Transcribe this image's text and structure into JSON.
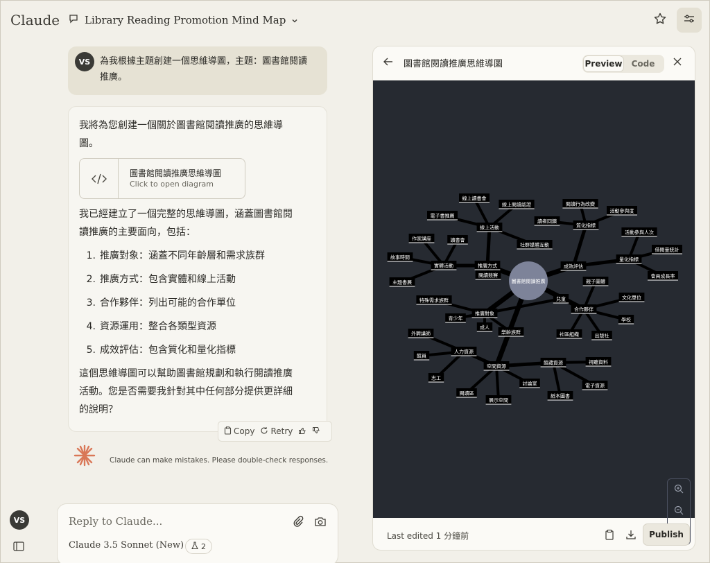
{
  "app": {
    "brand": "Claude"
  },
  "header": {
    "chat_title": "Library Reading Promotion Mind Map"
  },
  "user": {
    "initials": "VS",
    "message": "為我根據主題創建一個思維導圖，主題：圖書館閱讀推廣。"
  },
  "assistant": {
    "intro": "我將為您創建一個關於圖書館閱讀推廣的思維導圖。",
    "artifact_card": {
      "title": "圖書館閱讀推廣思維導圖",
      "subtitle": "Click to open diagram"
    },
    "summary": "我已經建立了一個完整的思維導圖，涵蓋圖書館閱讀推廣的主要面向，包括：",
    "points": [
      {
        "num": "1.",
        "text": "推廣對象：涵蓋不同年齡層和需求族群"
      },
      {
        "num": "2.",
        "text": "推廣方式：包含實體和線上活動"
      },
      {
        "num": "3.",
        "text": "合作夥伴：列出可能的合作單位"
      },
      {
        "num": "4.",
        "text": "資源運用：整合各類型資源"
      },
      {
        "num": "5.",
        "text": "成效評估：包含質化和量化指標"
      }
    ],
    "closing": "這個思維導圖可以幫助圖書館規劃和執行閱讀推廣活動。您是否需要我針對其中任何部分提供更詳細的說明？",
    "actions": {
      "copy": "Copy",
      "retry": "Retry"
    }
  },
  "disclaimer": "Claude can make mistakes. Please double-check responses.",
  "reply": {
    "placeholder": "Reply to Claude...",
    "model": "Claude 3.5 Sonnet (New)",
    "style_count": "2"
  },
  "panel": {
    "title": "圖書館閱讀推廣思維導圖",
    "tabs": {
      "preview": "Preview",
      "code": "Code"
    },
    "footer": {
      "last_edited": "Last edited 1 分鐘前",
      "publish": "Publish"
    }
  },
  "mindmap": {
    "center": "圖書館閱讀推廣",
    "nodes": [
      {
        "id": "fs",
        "label": "推廣方式"
      },
      {
        "id": "dx",
        "label": "推廣對象"
      },
      {
        "id": "hz",
        "label": "合作夥伴"
      },
      {
        "id": "zy",
        "label": "空間資源"
      },
      {
        "id": "pg",
        "label": "成效評估"
      },
      {
        "id": "xs",
        "label": "線上活動"
      },
      {
        "id": "st",
        "label": "實體活動"
      },
      {
        "id": "zl",
        "label": "閱讀競賽"
      },
      {
        "id": "xsdsh",
        "label": "線上讀書會"
      },
      {
        "id": "xsydlc",
        "label": "線上閱讀認證"
      },
      {
        "id": "dzsh",
        "label": "電子書推薦"
      },
      {
        "id": "sjmt",
        "label": "社群媒體互動"
      },
      {
        "id": "zjjz",
        "label": "作家講座"
      },
      {
        "id": "dsh",
        "label": "讀書會"
      },
      {
        "id": "gssj",
        "label": "故事時間"
      },
      {
        "id": "zsd",
        "label": "主題書展"
      },
      {
        "id": "zhbz",
        "label": "質化指標"
      },
      {
        "id": "ydxw",
        "label": "閱讀行為改變"
      },
      {
        "id": "dzfk",
        "label": "讀者回饋"
      },
      {
        "id": "hdcy",
        "label": "活動參與度"
      },
      {
        "id": "lhzb",
        "label": "量化指標"
      },
      {
        "id": "hdcyrc",
        "label": "活動參與人次"
      },
      {
        "id": "jyl",
        "label": "借閱量統計"
      },
      {
        "id": "hysz",
        "label": "會員成長率"
      },
      {
        "id": "tsxq",
        "label": "特殊需求族群"
      },
      {
        "id": "qsn",
        "label": "青少年"
      },
      {
        "id": "cr",
        "label": "成人"
      },
      {
        "id": "etq",
        "label": "兒童"
      },
      {
        "id": "lnz",
        "label": "樂齡族群"
      },
      {
        "id": "jzxh",
        "label": "親子團體"
      },
      {
        "id": "whdw",
        "label": "文化單位"
      },
      {
        "id": "xx",
        "label": "學校"
      },
      {
        "id": "cbs",
        "label": "出版社"
      },
      {
        "id": "sqzz",
        "label": "社區組織"
      },
      {
        "id": "rlzy",
        "label": "人力資源"
      },
      {
        "id": "wpjs",
        "label": "外聘講師"
      },
      {
        "id": "gy",
        "label": "館員"
      },
      {
        "id": "zg",
        "label": "志工"
      },
      {
        "id": "gczy",
        "label": "館藏資源"
      },
      {
        "id": "styzl",
        "label": "視聽資料"
      },
      {
        "id": "dzzy",
        "label": "電子資源"
      },
      {
        "id": "zbts",
        "label": "紙本圖書"
      },
      {
        "id": "tls",
        "label": "討論室"
      },
      {
        "id": "zskj",
        "label": "展示空間"
      },
      {
        "id": "ydq",
        "label": "閱讀區"
      }
    ]
  }
}
